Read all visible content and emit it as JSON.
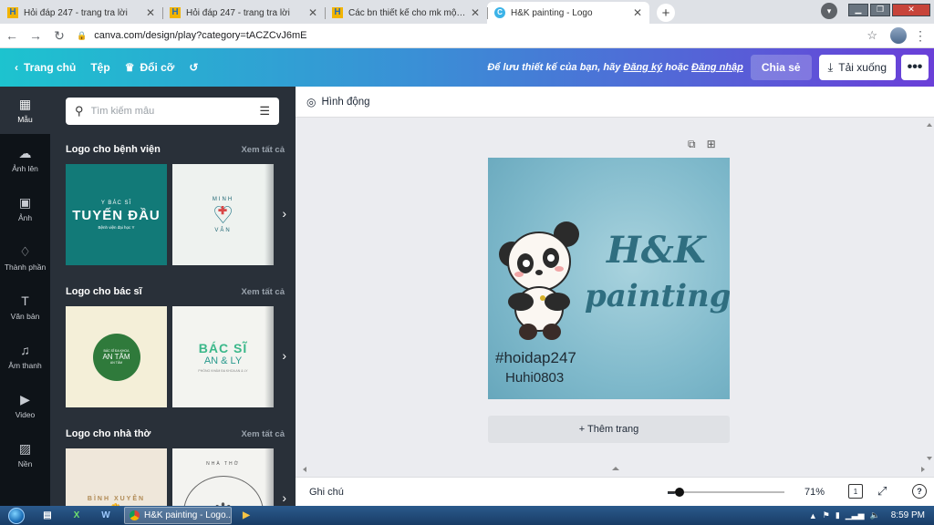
{
  "browser": {
    "tabs": [
      {
        "title": "Hỏi đáp 247 - trang tra lời",
        "favicon": "hoidap-favicon-icon"
      },
      {
        "title": "Hỏi đáp 247 - trang tra lời",
        "favicon": "hoidap-favicon-icon"
      },
      {
        "title": "Các bn thiết kế cho mk một logo",
        "favicon": "hoidap-favicon-icon"
      },
      {
        "title": "H&K painting - Logo",
        "favicon": "canva-favicon-icon",
        "active": true
      }
    ],
    "url": "canva.com/design/play?category=tACZCvJ6mE",
    "profile_initial": "▾"
  },
  "header": {
    "home": "Trang chủ",
    "file": "Tệp",
    "resize": "Đổi cỡ",
    "message_prefix": "Để lưu thiết kế của bạn, hãy",
    "signup": "Đăng ký",
    "message_or": "hoặc",
    "login": "Đăng nhập",
    "share": "Chia sẻ",
    "download": "Tải xuống"
  },
  "rail": [
    {
      "label": "Mẫu",
      "icon": "template-icon"
    },
    {
      "label": "Ảnh lên",
      "icon": "upload-icon"
    },
    {
      "label": "Ảnh",
      "icon": "photo-icon"
    },
    {
      "label": "Thành phần",
      "icon": "elements-icon"
    },
    {
      "label": "Văn bản",
      "icon": "text-icon"
    },
    {
      "label": "Âm thanh",
      "icon": "music-icon"
    },
    {
      "label": "Video",
      "icon": "video-icon"
    },
    {
      "label": "Nền",
      "icon": "background-icon"
    }
  ],
  "panel": {
    "search_placeholder": "Tìm kiếm mẫu",
    "see_all": "Xem tất cả",
    "sections": [
      {
        "title": "Logo cho bệnh viện",
        "thumb1": {
          "line1": "Y BÁC SĨ",
          "line2": "TUYẾN ĐẦU",
          "line3": "Bệnh viện đại học Y"
        },
        "thumb2": {
          "line1": "MINH",
          "line2": "VÂN",
          "small": "PHÒNG KHÁM"
        }
      },
      {
        "title": "Logo cho bác sĩ",
        "thumb1": {
          "line1": "AN TÂM",
          "small_top": "BÁC SĨ ĐA KHOA",
          "small_bottom": "AN TÂM"
        },
        "thumb2": {
          "line1": "BÁC SĨ",
          "line2": "AN & LY",
          "line3": "PHÒNG KHÁM ĐA KHOA AN & LY"
        }
      },
      {
        "title": "Logo cho nhà thờ",
        "thumb1": {
          "line1": "BÌNH XUYÊN"
        },
        "thumb2": {
          "line1": "NHÀ THỜ"
        }
      }
    ]
  },
  "editor": {
    "toolbar_label": "Hình động",
    "design": {
      "title_line1": "H&K",
      "title_line2": "painting",
      "tag1": "#hoidap247",
      "tag2": "Huhi0803"
    },
    "add_page": "+ Thêm trang"
  },
  "footer": {
    "notes": "Ghi chú",
    "zoom": "71%",
    "zoom_fraction": 0.1,
    "page_count": "1",
    "help": "?"
  },
  "taskbar": {
    "app_label": "H&K painting - Logo...",
    "clock": "8:59 PM"
  },
  "colors": {
    "header_start": "#1dc3cf",
    "header_end": "#6a3fd8",
    "panel_bg": "#293039",
    "rail_bg": "#0e1318",
    "editor_bg": "#ebecf0"
  }
}
